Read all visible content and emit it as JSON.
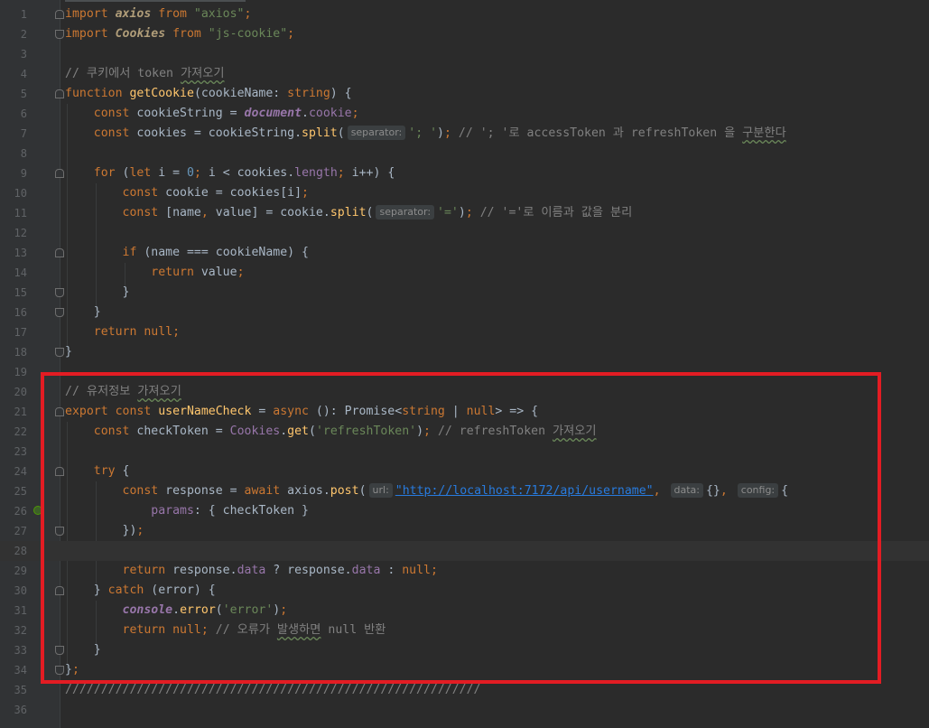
{
  "editor": {
    "lines": [
      {
        "n": "1",
        "tokens": [
          [
            "kw",
            "import "
          ],
          [
            "cls",
            "axios"
          ],
          [
            "kw",
            " from "
          ],
          [
            "str",
            "\"axios\""
          ],
          [
            "kw",
            ";"
          ]
        ]
      },
      {
        "n": "2",
        "tokens": [
          [
            "kw",
            "import "
          ],
          [
            "cls",
            "Cookies"
          ],
          [
            "kw",
            " from "
          ],
          [
            "str",
            "\"js-cookie\""
          ],
          [
            "kw",
            ";"
          ]
        ]
      },
      {
        "n": "3",
        "tokens": []
      },
      {
        "n": "4",
        "tokens": [
          [
            "cmt",
            "// 쿠키에서 token "
          ],
          [
            "cmt squig",
            "가져오기"
          ]
        ]
      },
      {
        "n": "5",
        "tokens": [
          [
            "kw",
            "function "
          ],
          [
            "fn",
            "getCookie"
          ],
          [
            "plain",
            "(cookieName: "
          ],
          [
            "kw",
            "string"
          ],
          [
            "plain",
            ") {"
          ]
        ]
      },
      {
        "n": "6",
        "tokens": [
          [
            "plain",
            "    "
          ],
          [
            "kw",
            "const "
          ],
          [
            "plain",
            "cookieString = "
          ],
          [
            "glob",
            "document"
          ],
          [
            "plain",
            "."
          ],
          [
            "prop",
            "cookie"
          ],
          [
            "kw",
            ";"
          ]
        ]
      },
      {
        "n": "7",
        "tokens": [
          [
            "plain",
            "    "
          ],
          [
            "kw",
            "const "
          ],
          [
            "plain",
            "cookies = cookieString."
          ],
          [
            "fn",
            "split"
          ],
          [
            "plain",
            "("
          ],
          [
            "hint",
            "separator:"
          ],
          [
            "str",
            "'; '"
          ],
          [
            "plain",
            ")"
          ],
          [
            "kw",
            ";"
          ],
          [
            "cmt",
            " // '; '로 accessToken 과 refreshToken 을 "
          ],
          [
            "cmt squig",
            "구분한다"
          ]
        ]
      },
      {
        "n": "8",
        "tokens": []
      },
      {
        "n": "9",
        "tokens": [
          [
            "plain",
            "    "
          ],
          [
            "kw",
            "for "
          ],
          [
            "plain",
            "("
          ],
          [
            "kw",
            "let "
          ],
          [
            "plain",
            "i = "
          ],
          [
            "num",
            "0"
          ],
          [
            "kw",
            "; "
          ],
          [
            "plain",
            "i < cookies."
          ],
          [
            "prop",
            "length"
          ],
          [
            "kw",
            "; "
          ],
          [
            "plain",
            "i++) {"
          ]
        ]
      },
      {
        "n": "10",
        "tokens": [
          [
            "plain",
            "        "
          ],
          [
            "kw",
            "const "
          ],
          [
            "plain",
            "cookie = cookies[i]"
          ],
          [
            "kw",
            ";"
          ]
        ]
      },
      {
        "n": "11",
        "tokens": [
          [
            "plain",
            "        "
          ],
          [
            "kw",
            "const "
          ],
          [
            "plain",
            "[name"
          ],
          [
            "kw",
            ", "
          ],
          [
            "plain",
            "value] = cookie."
          ],
          [
            "fn",
            "split"
          ],
          [
            "plain",
            "("
          ],
          [
            "hint",
            "separator:"
          ],
          [
            "str",
            "'='"
          ],
          [
            "plain",
            ")"
          ],
          [
            "kw",
            ";"
          ],
          [
            "cmt",
            " // '='로 이름과 값을 분리"
          ]
        ]
      },
      {
        "n": "12",
        "tokens": []
      },
      {
        "n": "13",
        "tokens": [
          [
            "plain",
            "        "
          ],
          [
            "kw",
            "if "
          ],
          [
            "plain",
            "(name === cookieName) {"
          ]
        ]
      },
      {
        "n": "14",
        "tokens": [
          [
            "plain",
            "            "
          ],
          [
            "kw",
            "return "
          ],
          [
            "plain",
            "value"
          ],
          [
            "kw",
            ";"
          ]
        ]
      },
      {
        "n": "15",
        "tokens": [
          [
            "plain",
            "        }"
          ]
        ]
      },
      {
        "n": "16",
        "tokens": [
          [
            "plain",
            "    }"
          ]
        ]
      },
      {
        "n": "17",
        "tokens": [
          [
            "plain",
            "    "
          ],
          [
            "kw",
            "return null;"
          ]
        ]
      },
      {
        "n": "18",
        "tokens": [
          [
            "plain",
            "}"
          ]
        ]
      },
      {
        "n": "19",
        "tokens": []
      },
      {
        "n": "20",
        "tokens": [
          [
            "cmt",
            "// 유저정보 "
          ],
          [
            "cmt squig",
            "가져오기"
          ]
        ]
      },
      {
        "n": "21",
        "tokens": [
          [
            "kw",
            "export const "
          ],
          [
            "fn",
            "userNameCheck"
          ],
          [
            "plain",
            " = "
          ],
          [
            "kw",
            "async "
          ],
          [
            "plain",
            "(): Promise<"
          ],
          [
            "kw",
            "string"
          ],
          [
            "plain",
            " | "
          ],
          [
            "kw",
            "null"
          ],
          [
            "plain",
            "> => {"
          ]
        ]
      },
      {
        "n": "22",
        "tokens": [
          [
            "plain",
            "    "
          ],
          [
            "kw",
            "const "
          ],
          [
            "plain",
            "checkToken = "
          ],
          [
            "prop",
            "Cookies"
          ],
          [
            "plain",
            "."
          ],
          [
            "fn",
            "get"
          ],
          [
            "plain",
            "("
          ],
          [
            "str",
            "'refreshToken'"
          ],
          [
            "plain",
            ")"
          ],
          [
            "kw",
            ";"
          ],
          [
            "cmt",
            " // refreshToken "
          ],
          [
            "cmt squig",
            "가져오기"
          ]
        ]
      },
      {
        "n": "23",
        "tokens": []
      },
      {
        "n": "24",
        "tokens": [
          [
            "plain",
            "    "
          ],
          [
            "kw",
            "try "
          ],
          [
            "plain",
            "{"
          ]
        ]
      },
      {
        "n": "25",
        "tokens": [
          [
            "plain",
            "        "
          ],
          [
            "kw",
            "const "
          ],
          [
            "plain",
            "response = "
          ],
          [
            "kw",
            "await "
          ],
          [
            "plain",
            "axios."
          ],
          [
            "fn",
            "post"
          ],
          [
            "plain",
            "("
          ],
          [
            "hint",
            "url:"
          ],
          [
            "url",
            "\"http://localhost:7172/api/username\""
          ],
          [
            "kw",
            ", "
          ],
          [
            "hint",
            "data:"
          ],
          [
            "plain",
            "{}"
          ],
          [
            "kw",
            ", "
          ],
          [
            "hint",
            "config:"
          ],
          [
            "plain",
            "{"
          ]
        ]
      },
      {
        "n": "26",
        "tokens": [
          [
            "plain",
            "            "
          ],
          [
            "prop",
            "params"
          ],
          [
            "plain",
            ": { checkToken }"
          ]
        ]
      },
      {
        "n": "27",
        "tokens": [
          [
            "plain",
            "        })"
          ],
          [
            "kw",
            ";"
          ]
        ]
      },
      {
        "n": "28",
        "tokens": []
      },
      {
        "n": "29",
        "tokens": [
          [
            "plain",
            "        "
          ],
          [
            "kw",
            "return "
          ],
          [
            "plain",
            "response."
          ],
          [
            "prop",
            "data"
          ],
          [
            "plain",
            " ? response."
          ],
          [
            "prop",
            "data"
          ],
          [
            "plain",
            " : "
          ],
          [
            "kw",
            "null;"
          ]
        ]
      },
      {
        "n": "30",
        "tokens": [
          [
            "plain",
            "    } "
          ],
          [
            "kw",
            "catch "
          ],
          [
            "plain",
            "(error) {"
          ]
        ]
      },
      {
        "n": "31",
        "tokens": [
          [
            "plain",
            "        "
          ],
          [
            "glob",
            "console"
          ],
          [
            "plain",
            "."
          ],
          [
            "fn",
            "error"
          ],
          [
            "plain",
            "("
          ],
          [
            "str",
            "'error'"
          ],
          [
            "plain",
            ")"
          ],
          [
            "kw",
            ";"
          ]
        ]
      },
      {
        "n": "32",
        "tokens": [
          [
            "plain",
            "        "
          ],
          [
            "kw",
            "return null; "
          ],
          [
            "cmt",
            "// 오류가 "
          ],
          [
            "cmt squig",
            "발생하면"
          ],
          [
            "cmt",
            " null 반환"
          ]
        ]
      },
      {
        "n": "33",
        "tokens": [
          [
            "plain",
            "    }"
          ]
        ]
      },
      {
        "n": "34",
        "tokens": [
          [
            "plain",
            "}"
          ],
          [
            "kw",
            ";"
          ]
        ]
      },
      {
        "n": "35",
        "tokens": [
          [
            "cmt",
            "//////////////////////////////////////////////////////////"
          ]
        ]
      },
      {
        "n": "36",
        "tokens": []
      }
    ],
    "current_line": "28"
  }
}
